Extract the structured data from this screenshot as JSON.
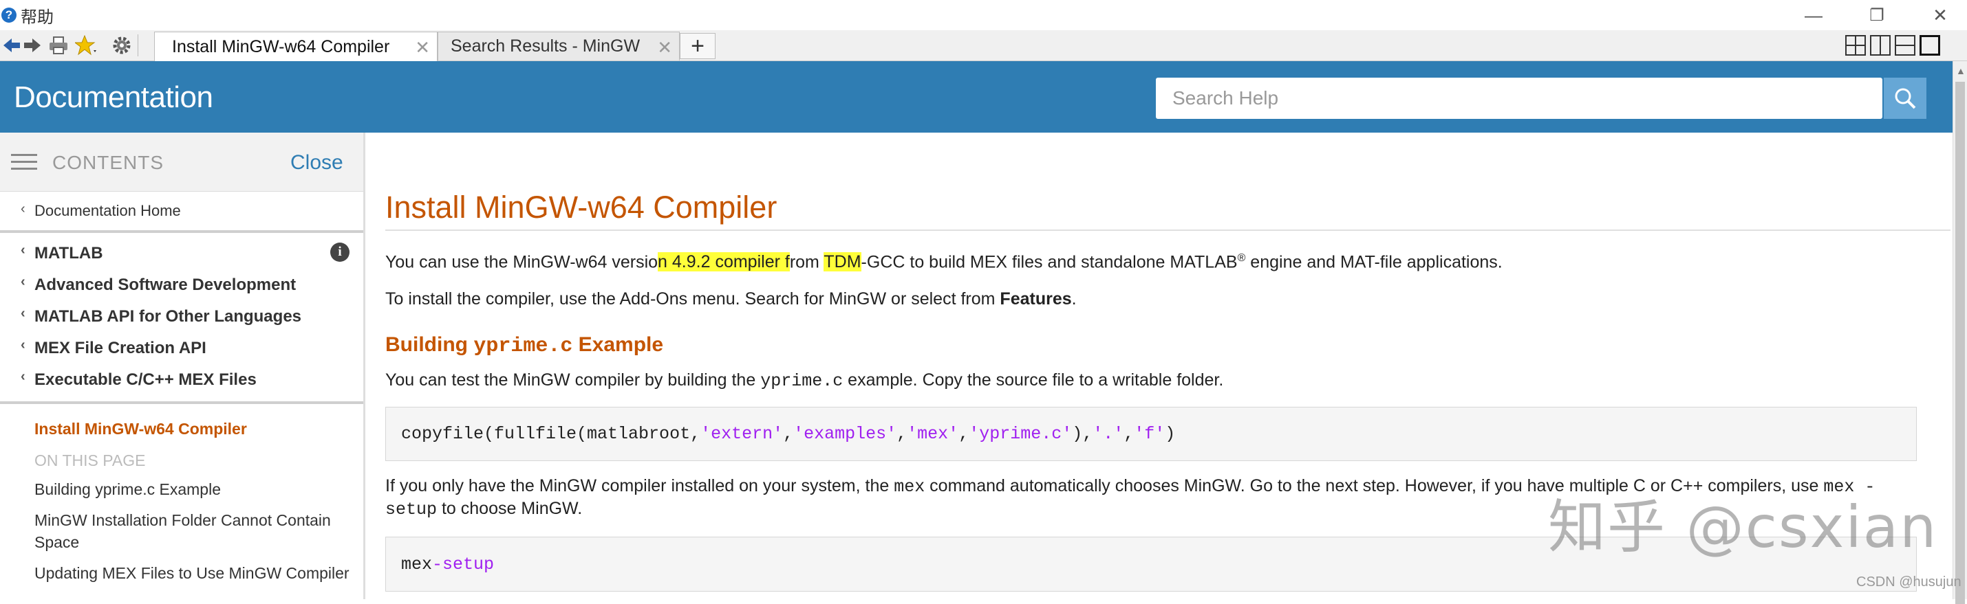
{
  "window": {
    "menu_help": "帮助",
    "controls": {
      "minimize": "—",
      "restore": "❐",
      "close": "✕"
    }
  },
  "toolbar": {
    "icons": [
      "back-arrow-icon",
      "forward-arrow-icon",
      "print-icon",
      "favorites-star-icon",
      "settings-gear-icon"
    ]
  },
  "tabs": [
    {
      "label": "Install MinGW-w64 Compiler",
      "active": true
    },
    {
      "label": "Search Results - MinGW",
      "active": false
    }
  ],
  "new_tab": "+",
  "header": {
    "title": "Documentation",
    "search_placeholder": "Search Help",
    "color": "#2f7db3"
  },
  "sidebar": {
    "contents_label": "CONTENTS",
    "close_label": "Close",
    "home": "Documentation Home",
    "breadcrumbs": [
      "MATLAB",
      "Advanced Software Development",
      "MATLAB API for Other Languages",
      "MEX File Creation API",
      "Executable C/C++ MEX Files"
    ],
    "current_page": "Install MinGW-w64 Compiler",
    "on_this_page": "ON THIS PAGE",
    "toc": [
      "Building yprime.c Example",
      "MinGW Installation Folder Cannot Contain Space",
      "Updating MEX Files to Use MinGW Compiler"
    ]
  },
  "content": {
    "title": "Install MinGW-w64 Compiler",
    "p1": {
      "a": "You can use the MinGW-w64 versio",
      "b": "n ",
      "c": "4.9.2 compiler f",
      "d": "rom ",
      "e": "TDM",
      "f": "-GCC to build MEX files and standalone MATLAB",
      "sup": "®",
      "g": " engine and MAT-file applications."
    },
    "p2": {
      "a": "To install the compiler, use the Add-Ons menu. Search for MinGW or select from ",
      "bold": "Features",
      "b": "."
    },
    "section_heading": {
      "a": "Building ",
      "code": "yprime.c",
      "b": " Example"
    },
    "p3": {
      "a": "You can test the MinGW compiler by building the ",
      "code": "yprime.c",
      "b": " example. Copy the source file to a writable folder."
    },
    "code1": {
      "a": "copyfile(fullfile(matlabroot,",
      "s1": "'extern'",
      "c1": ",",
      "s2": "'examples'",
      "c2": ",",
      "s3": "'mex'",
      "c3": ",",
      "s4": "'yprime.c'",
      "c4": "),",
      "s5": "'.'",
      "c5": ",",
      "s6": "'f'",
      "c6": ")"
    },
    "p4": {
      "a": "If you only have the MinGW compiler installed on your system, the ",
      "code": "mex",
      "b": " command automatically chooses MinGW. Go to the next step. However, if you have multiple C or C++ compilers, use ",
      "code2": "mex -",
      "line2_code": "setup",
      "line2": " to choose MinGW."
    },
    "code2": {
      "cmd": "mex ",
      "flag": "-setup"
    },
    "highlight_color": "#ffff3a",
    "heading_color": "#c45500"
  },
  "watermark": "知乎 @csxian",
  "credit": "CSDN @husujun"
}
